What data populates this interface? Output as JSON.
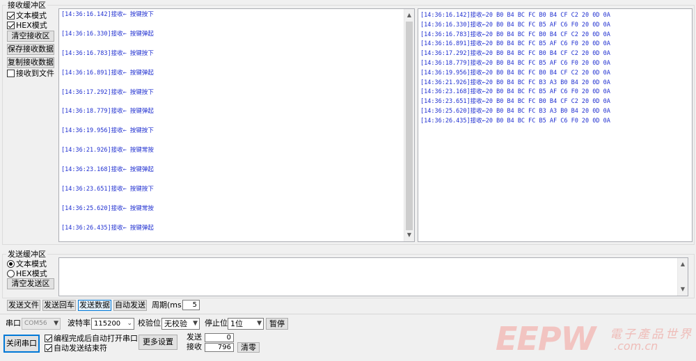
{
  "receive_group": {
    "title": "接收缓冲区",
    "text_mode_label": "文本模式",
    "hex_mode_label": "HEX模式",
    "clear_button": "清空接收区",
    "save_button": "保存接收数据",
    "copy_button": "复制接收数据",
    "to_file_label": "接收到文件",
    "text_lines": [
      "[14:36:16.142]接收← 按键按下",
      "[14:36:16.330]接收← 按键弹起",
      "[14:36:16.783]接收← 按键按下",
      "[14:36:16.891]接收← 按键弹起",
      "[14:36:17.292]接收← 按键按下",
      "[14:36:18.779]接收← 按键弹起",
      "[14:36:19.956]接收← 按键按下",
      "[14:36:21.926]接收← 按键常按",
      "[14:36:23.168]接收← 按键弹起",
      "[14:36:23.651]接收← 按键按下",
      "[14:36:25.620]接收← 按键常按",
      "[14:36:26.435]接收← 按键弹起"
    ],
    "hex_lines": [
      "[14:36:16.142]接收←20 B0 B4 BC FC B0 B4 CF C2 20 0D 0A",
      "[14:36:16.330]接收←20 B0 B4 BC FC B5 AF C6 F0 20 0D 0A",
      "[14:36:16.783]接收←20 B0 B4 BC FC B0 B4 CF C2 20 0D 0A",
      "[14:36:16.891]接收←20 B0 B4 BC FC B5 AF C6 F0 20 0D 0A",
      "[14:36:17.292]接收←20 B0 B4 BC FC B0 B4 CF C2 20 0D 0A",
      "[14:36:18.779]接收←20 B0 B4 BC FC B5 AF C6 F0 20 0D 0A",
      "[14:36:19.956]接收←20 B0 B4 BC FC B0 B4 CF C2 20 0D 0A",
      "[14:36:21.926]接收←20 B0 B4 BC FC B3 A3 B0 B4 20 0D 0A",
      "[14:36:23.168]接收←20 B0 B4 BC FC B5 AF C6 F0 20 0D 0A",
      "[14:36:23.651]接收←20 B0 B4 BC FC B0 B4 CF C2 20 0D 0A",
      "[14:36:25.620]接收←20 B0 B4 BC FC B3 A3 B0 B4 20 0D 0A",
      "[14:36:26.435]接收←20 B0 B4 BC FC B5 AF C6 F0 20 0D 0A"
    ]
  },
  "send_group": {
    "title": "发送缓冲区",
    "text_mode_label": "文本模式",
    "hex_mode_label": "HEX模式",
    "clear_button": "清空发送区",
    "send_value": ""
  },
  "send_controls": {
    "send_file": "发送文件",
    "send_return": "发送回车",
    "send_data": "发送数据",
    "auto_send": "自动发送",
    "period_label": "周期(ms)",
    "period_value": "5"
  },
  "port_settings": {
    "port_label": "串口",
    "port_value": "COM56",
    "baud_label": "波特率",
    "baud_value": "115200",
    "parity_label": "校验位",
    "parity_value": "无校验",
    "stop_label": "停止位",
    "stop_value": "1位",
    "pause_button": "暂停",
    "close_port_button": "关闭串口",
    "auto_open_label": "编程完成后自动打开串口",
    "auto_end_label": "自动发送结束符",
    "more_settings_button": "更多设置",
    "sent_label": "发送",
    "sent_value": "0",
    "recv_label": "接收",
    "recv_value": "796",
    "clear_count_button": "清零"
  },
  "watermark": {
    "brand": "EEPW",
    "cn": "電子產品世界",
    "url": ".com.cn"
  },
  "colors": {
    "accent": "#0078d7",
    "receive_text": "#1f2fd0"
  }
}
